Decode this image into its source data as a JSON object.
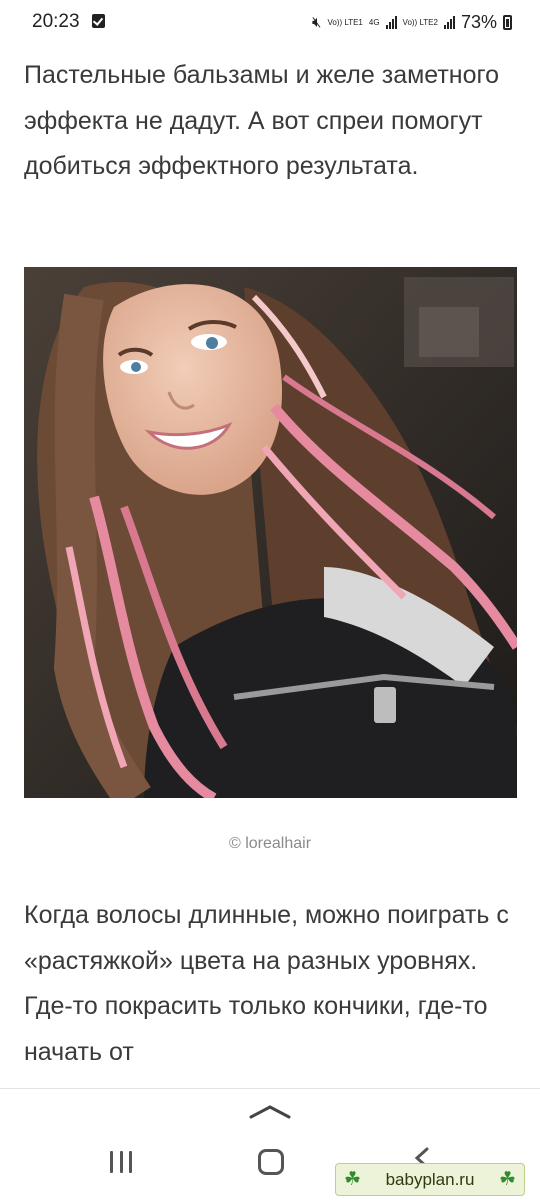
{
  "status_bar": {
    "time": "20:23",
    "volte_1": "Vo)) LTE1",
    "network": "4G",
    "volte_2": "Vo)) LTE2",
    "battery": "73%"
  },
  "article": {
    "paragraph_1": "Пастельные бальзамы и желе заметного эффекта не дадут. А вот спреи помогут добиться эффектного результата.",
    "photo_caption": "© lorealhair",
    "paragraph_2": "Когда волосы длинные, можно поиграть с «растяжкой» цвета на разных уровнях. Где-то покрасить только кончики, где-то начать от"
  },
  "watermark": {
    "text": "babyplan.ru"
  },
  "colors": {
    "hair_brown": "#6b4a36",
    "hair_pink": "#e68aa0",
    "jacket": "#1f1f22",
    "background_dark": "#3b342f"
  }
}
